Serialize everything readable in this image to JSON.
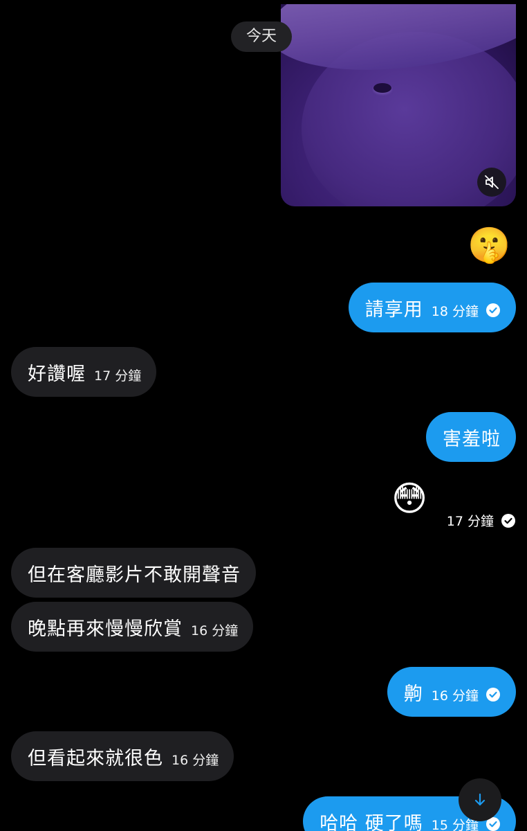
{
  "date_divider": "今天",
  "video": {
    "muted_icon": "speaker-muted-icon"
  },
  "emoji_1": "🤫",
  "emoji_2": "😳",
  "messages": [
    {
      "direction": "out",
      "text": "請享用",
      "time": "18 分鐘",
      "read": true
    },
    {
      "direction": "in",
      "text": "好讚喔",
      "time": "17 分鐘"
    },
    {
      "direction": "out",
      "text": "害羞啦",
      "time": ""
    },
    {
      "direction": "in",
      "text": "但在客廳影片不敢開聲音",
      "time": ""
    },
    {
      "direction": "in",
      "text": "晚點再來慢慢欣賞",
      "time": "16 分鐘"
    },
    {
      "direction": "out",
      "text": "齁",
      "time": "16 分鐘",
      "read": true
    },
    {
      "direction": "in",
      "text": "但看起來就很色",
      "time": "16 分鐘"
    },
    {
      "direction": "out",
      "text": "哈哈 硬了嗎",
      "time": "15 分鐘",
      "read": true
    }
  ],
  "emoji_2_time": "17 分鐘",
  "colors": {
    "background": "#000000",
    "outgoing_bubble": "#1c9bef",
    "incoming_bubble": "#1f1f22"
  },
  "icons": {
    "read_receipt": "check-circle-icon",
    "scroll": "arrow-down-icon"
  }
}
